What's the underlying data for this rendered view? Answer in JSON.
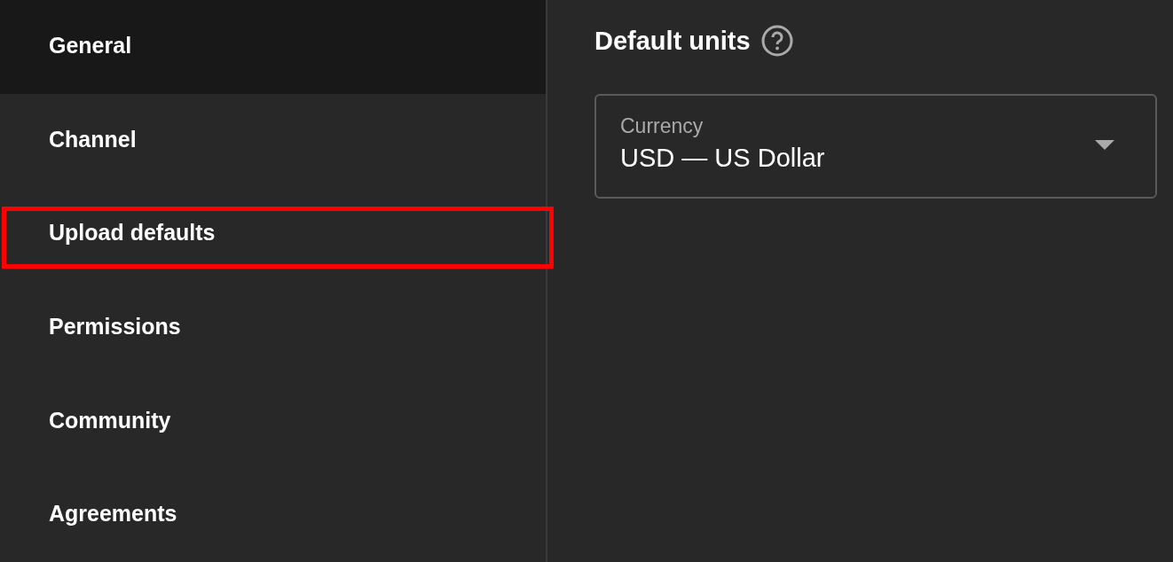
{
  "sidebar": {
    "items": [
      {
        "label": "General",
        "selected": true,
        "highlighted": false
      },
      {
        "label": "Channel",
        "selected": false,
        "highlighted": false
      },
      {
        "label": "Upload defaults",
        "selected": false,
        "highlighted": true
      },
      {
        "label": "Permissions",
        "selected": false,
        "highlighted": false
      },
      {
        "label": "Community",
        "selected": false,
        "highlighted": false
      },
      {
        "label": "Agreements",
        "selected": false,
        "highlighted": false
      }
    ]
  },
  "section": {
    "title": "Default units",
    "field": {
      "label": "Currency",
      "value": "USD — US Dollar"
    }
  }
}
